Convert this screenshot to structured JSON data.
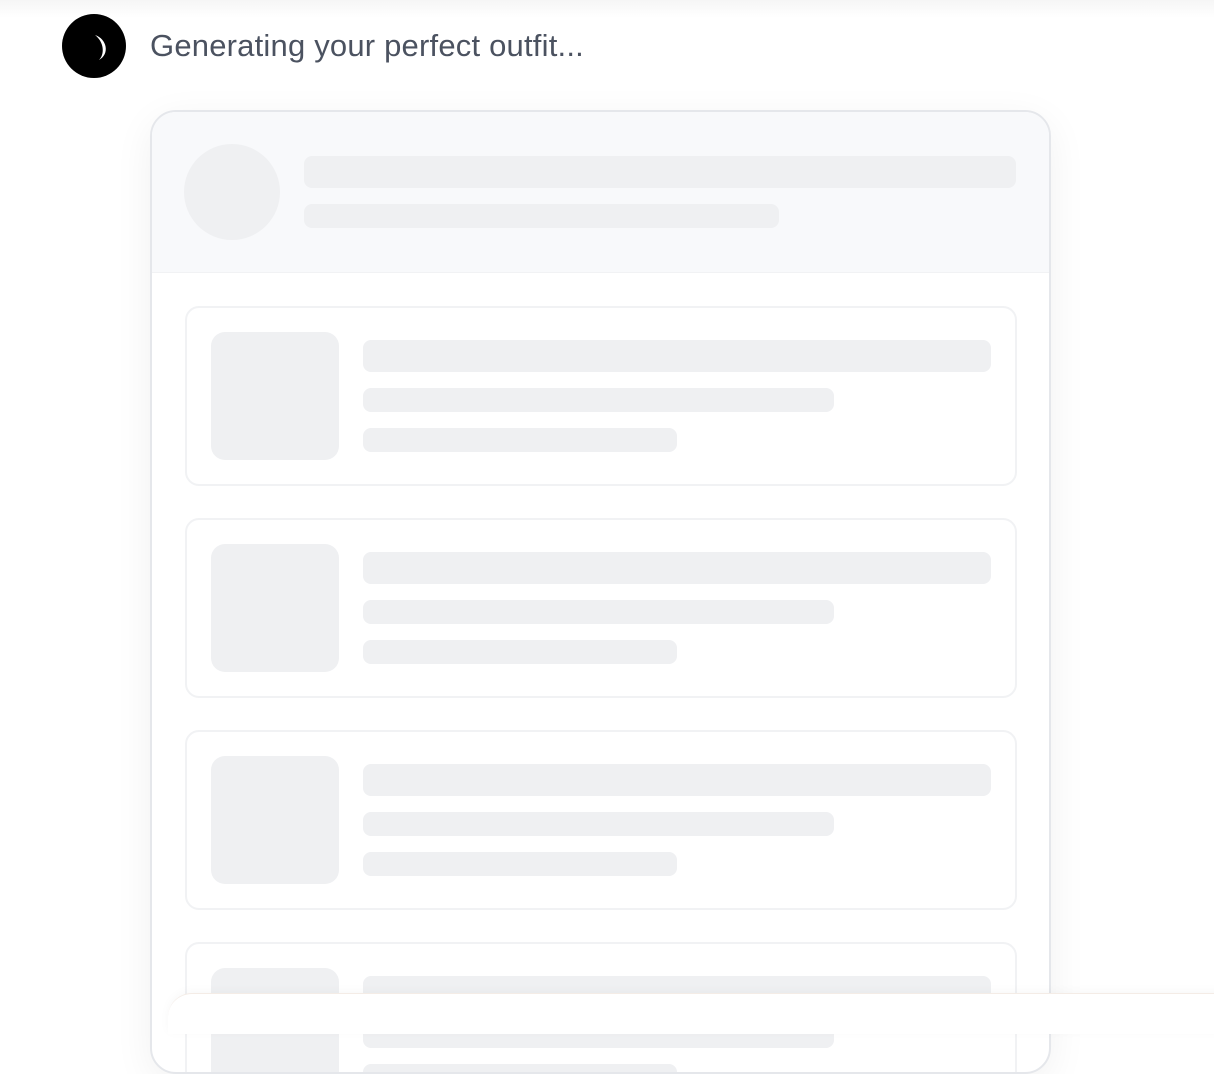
{
  "status": {
    "icon": "loading-spinner-icon",
    "text": "Generating your perfect outfit..."
  },
  "colors": {
    "skeleton": "#eff0f2",
    "header_bg": "#f8f9fb",
    "border": "#e5e7eb",
    "status_text": "#4b5260"
  },
  "loading_card": {
    "item_count_visible": 4
  }
}
